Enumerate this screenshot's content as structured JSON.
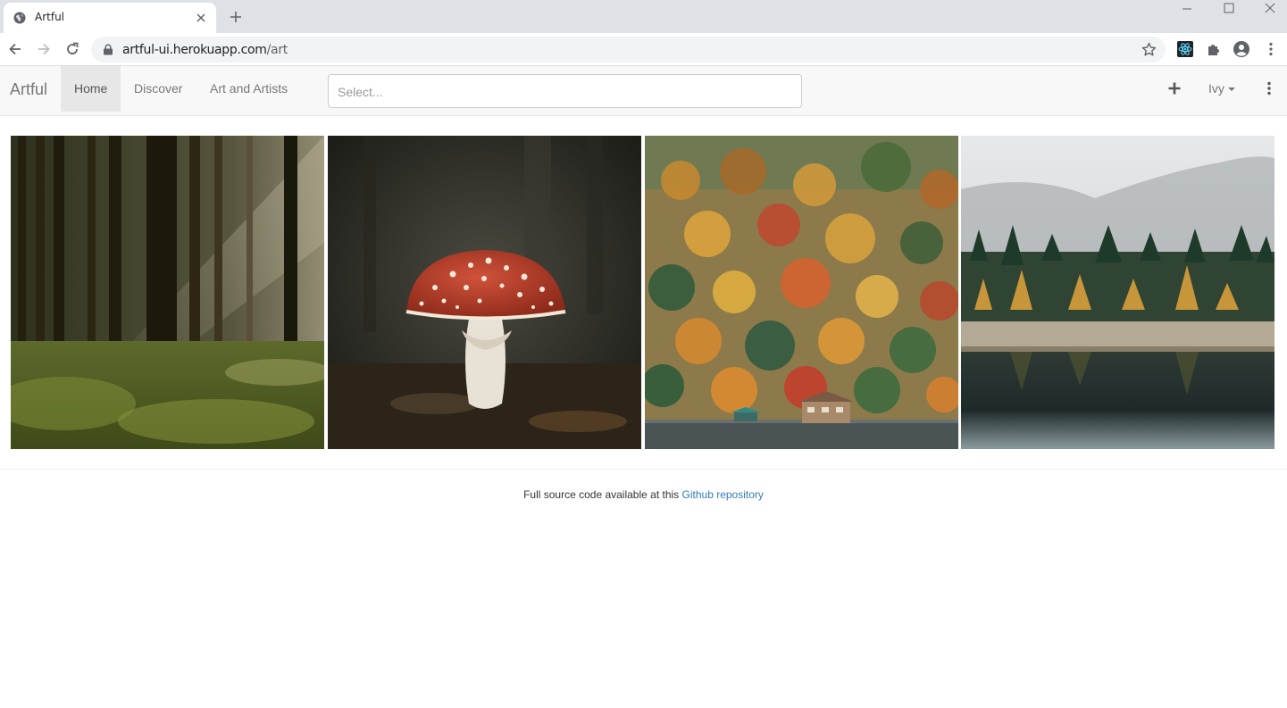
{
  "browser": {
    "tab_title": "Artful",
    "url_host": "artful-ui.herokuapp.com",
    "url_path": "/art"
  },
  "navbar": {
    "brand": "Artful",
    "items": [
      {
        "label": "Home",
        "active": true
      },
      {
        "label": "Discover",
        "active": false
      },
      {
        "label": "Art and Artists",
        "active": false
      }
    ],
    "search_placeholder": "Select...",
    "user": "Ivy"
  },
  "gallery": {
    "items": [
      {
        "subject": "sunlit pine forest"
      },
      {
        "subject": "red fly agaric mushroom"
      },
      {
        "subject": "autumn hillside with lake house"
      },
      {
        "subject": "misty forest reflected in lake"
      }
    ]
  },
  "footer": {
    "text": "Full source code available at this ",
    "link_text": "Github repository"
  },
  "colors": {
    "link": "#337ab7",
    "navbar_bg": "#f8f8f8",
    "active_tab_bg": "#e7e7e7"
  }
}
